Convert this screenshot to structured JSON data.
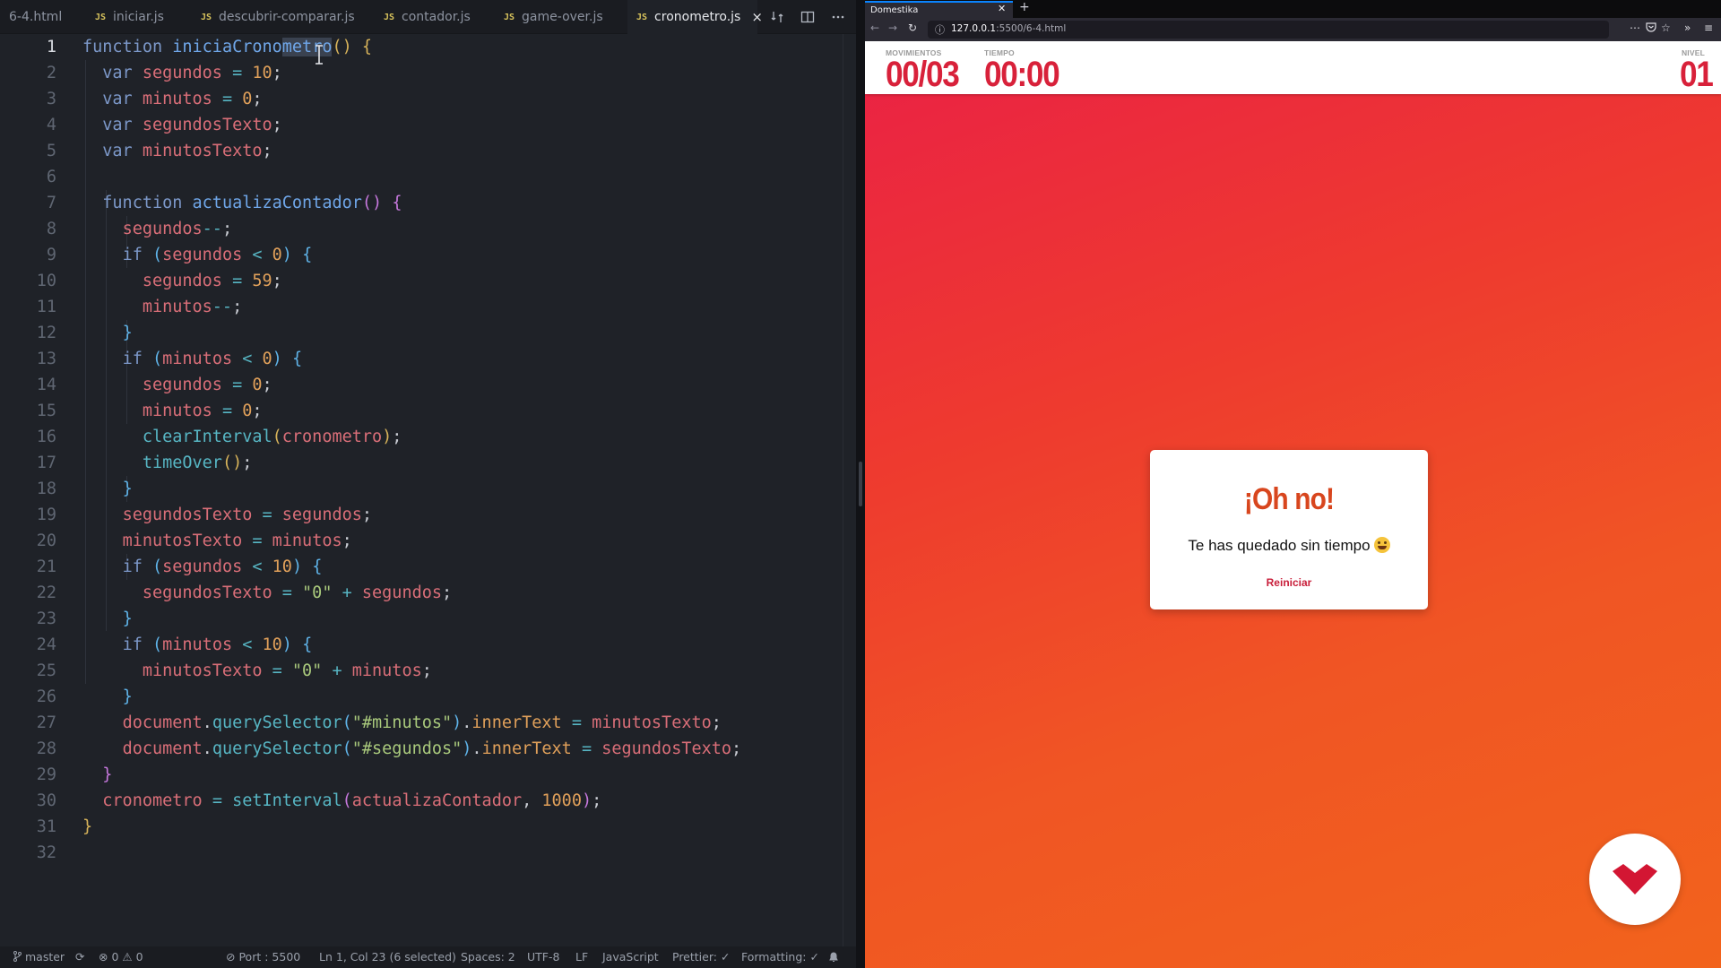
{
  "editor": {
    "tabs": [
      {
        "label": "6-4.html",
        "type": "html"
      },
      {
        "label": "iniciar.js",
        "badge": "JS"
      },
      {
        "label": "descubrir-comparar.js",
        "badge": "JS"
      },
      {
        "label": "contador.js",
        "badge": "JS"
      },
      {
        "label": "game-over.js",
        "badge": "JS"
      },
      {
        "label": "cronometro.js",
        "badge": "JS",
        "active": true
      }
    ],
    "tab_close": "×",
    "line_numbers": [
      "1",
      "2",
      "3",
      "4",
      "5",
      "6",
      "7",
      "8",
      "9",
      "10",
      "11",
      "12",
      "13",
      "14",
      "15",
      "16",
      "17",
      "18",
      "19",
      "20",
      "21",
      "22",
      "23",
      "24",
      "25",
      "26",
      "27",
      "28",
      "29",
      "30",
      "31",
      "32"
    ],
    "code": {
      "l1_kw": "function",
      "l1_fn": "iniciaCronometro",
      "l1_sel": "metro",
      "l1_rest": "() {",
      "var": "var",
      "segundos": "segundos",
      "minutos": "minutos",
      "segundosTexto": "segundosTexto",
      "minutosTexto": "minutosTexto",
      "n10": "10",
      "n0": "0",
      "n59": "59",
      "n1000": "1000",
      "actualizaContador": "actualizaContador",
      "if": "if",
      "clearInterval": "clearInterval",
      "cronometro": "cronometro",
      "timeOver": "timeOver",
      "str0": "\"0\"",
      "document": "document",
      "querySelector": "querySelector",
      "innerText": "innerText",
      "str_min": "\"#minutos\"",
      "str_seg": "\"#segundos\"",
      "setInterval": "setInterval"
    }
  },
  "statusbar": {
    "branch": "master",
    "errors": "0",
    "warnings": "0",
    "port": "Port : 5500",
    "cursor": "Ln 1, Col 23 (6 selected)",
    "spaces": "Spaces: 2",
    "encoding": "UTF-8",
    "eol": "LF",
    "language": "JavaScript",
    "prettier": "Prettier: ✓",
    "formatting": "Formatting: ✓"
  },
  "browser": {
    "tab_title": "Domestika",
    "url_host": "127.0.0.1",
    "url_rest": ":5500/6-4.html"
  },
  "game": {
    "movimientos_label": "MOVIMIENTOS",
    "movimientos_value": "00/03",
    "tiempo_label": "TIEMPO",
    "tiempo_value": "00:00",
    "nivel_label": "NIVEL",
    "nivel_value": "01",
    "modal_title": "¡Oh no!",
    "modal_message": "Te has quedado sin tiempo",
    "modal_button": "Reiniciar"
  },
  "colors": {
    "accent_red": "#d8213a",
    "brand_badge": "#d31633"
  }
}
